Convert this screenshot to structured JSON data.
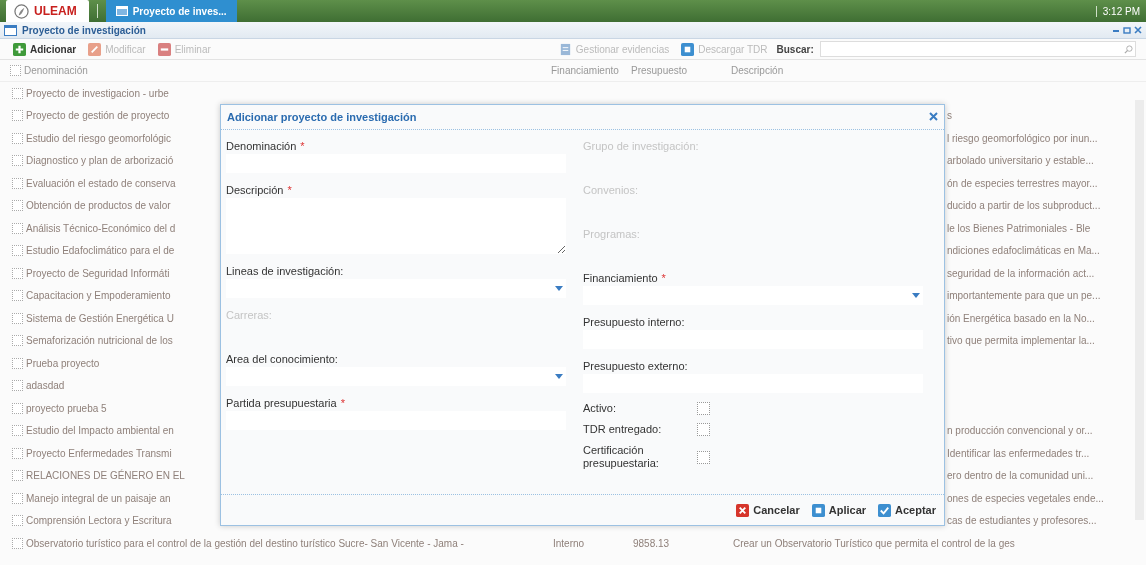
{
  "taskbar": {
    "logo_text": "ULEAM",
    "tabs": [
      {
        "label": "Proyecto de inves...",
        "selected": true
      }
    ],
    "clock": "3:12 PM"
  },
  "window": {
    "title": "Proyecto de investigación"
  },
  "toolbar": {
    "buttons": [
      {
        "label": "Adicionar",
        "kind": "add",
        "disabled": false
      },
      {
        "label": "Modificar",
        "kind": "edit",
        "disabled": true
      },
      {
        "label": "Eliminar",
        "kind": "delete",
        "disabled": true
      }
    ],
    "extra_buttons": [
      {
        "label": "Gestionar evidencias",
        "kind": "doc",
        "disabled": true
      },
      {
        "label": "Descargar TDR",
        "kind": "apply",
        "disabled": true
      }
    ],
    "search_label": "Buscar:"
  },
  "table": {
    "header_checked": false,
    "columns": [
      "Denominación",
      "Financiamiento",
      "Presupuesto",
      "Descripción"
    ],
    "rows": [
      {
        "checked": false,
        "name": "Proyecto de investigacion - urbe"
      },
      {
        "checked": false,
        "name": "Proyecto de gestión de proyecto",
        "description": "s"
      },
      {
        "checked": false,
        "name": "Estudio del riesgo geomorfológic",
        "description": "l riesgo geomorfológico por inun..."
      },
      {
        "checked": false,
        "name": "Diagnostico y plan de arborizació",
        "description": "arbolado universitario y estable..."
      },
      {
        "checked": false,
        "name": "Evaluación el estado de conserva",
        "description": "ón de especies terrestres mayor..."
      },
      {
        "checked": false,
        "name": "Obtención de productos de valor",
        "description": "ducido a partir de los subproduct..."
      },
      {
        "checked": false,
        "name": "Análisis Técnico-Económico del d",
        "description": "le los Bienes Patrimoniales - Ble"
      },
      {
        "checked": false,
        "name": "Estudio Edafoclimático para el de",
        "description": "ndiciones edafoclimáticas en Ma..."
      },
      {
        "checked": false,
        "name": "Proyecto de Seguridad Informáti",
        "description": "seguridad de la información act..."
      },
      {
        "checked": false,
        "name": "Capacitacion y Empoderamiento",
        "description": "importantemente para que un pe..."
      },
      {
        "checked": false,
        "name": "Sistema de Gestión Energética U",
        "description": "ión Energética basado en la No..."
      },
      {
        "checked": false,
        "name": "Semaforización nutricional de los",
        "description": "tivo que permita implementar la..."
      },
      {
        "checked": false,
        "name": "Prueba proyecto"
      },
      {
        "checked": false,
        "name": "adasdad"
      },
      {
        "checked": false,
        "name": "proyecto prueba 5"
      },
      {
        "checked": false,
        "name": "Estudio del Impacto ambiental en",
        "description": "n producción convencional y or..."
      },
      {
        "checked": false,
        "name": "Proyecto Enfermedades Transmi",
        "description": "Identificar las enfermedades tr..."
      },
      {
        "checked": false,
        "name": "RELACIONES DE GÉNERO EN EL",
        "description": "ero dentro de la comunidad uni..."
      },
      {
        "checked": false,
        "name": "Manejo integral de un paisaje an",
        "description": "ones de especies vegetales ende..."
      },
      {
        "checked": false,
        "name": "Comprensión Lectora y Escritura",
        "description": "cas de estudiantes y profesores..."
      },
      {
        "checked": false,
        "name": "Observatorio turístico para el control de la gestión del destino turístico Sucre- San Vicente - Jama -",
        "financing": "Interno",
        "budget": "9858.13",
        "description": "Crear un Observatorio Turístico que permita el control de la ges"
      }
    ]
  },
  "dialog": {
    "title": "Adicionar proyecto de investigación",
    "left_fields": [
      {
        "label": "Denominación",
        "required_mark": "*",
        "kind": "text",
        "disabled": false
      },
      {
        "label": "Descripción",
        "required_mark": "*",
        "kind": "textarea",
        "disabled": false
      },
      {
        "label": "Lineas de investigación:",
        "kind": "select",
        "disabled": false
      },
      {
        "label": "Carreras:",
        "kind": "text",
        "disabled": true
      },
      {
        "label": "Area del conocimiento:",
        "kind": "select",
        "disabled": false
      },
      {
        "label": "Partida presupuestaria",
        "required_mark": "*",
        "kind": "text",
        "disabled": false
      }
    ],
    "right_fields": [
      {
        "label": "Grupo de investigación:",
        "kind": "text",
        "disabled": true
      },
      {
        "label": "Convenios:",
        "kind": "text",
        "disabled": true
      },
      {
        "label": "Programas:",
        "kind": "text",
        "disabled": true
      },
      {
        "label": "Financiamiento",
        "required_mark": "*",
        "kind": "select",
        "disabled": false
      },
      {
        "label": "Presupuesto interno:",
        "kind": "text",
        "disabled": false
      },
      {
        "label": "Presupuesto externo:",
        "kind": "text",
        "disabled": false
      },
      {
        "label": "Activo:",
        "kind": "checkbox",
        "checked": false
      },
      {
        "label": "TDR entregado:",
        "kind": "checkbox",
        "checked": false
      },
      {
        "label": "Certificación presupuestaria:",
        "kind": "checkbox",
        "checked": false
      }
    ],
    "buttons": [
      {
        "label": "Cancelar",
        "kind": "cancel"
      },
      {
        "label": "Aplicar",
        "kind": "apply"
      },
      {
        "label": "Aceptar",
        "kind": "ok"
      }
    ]
  }
}
